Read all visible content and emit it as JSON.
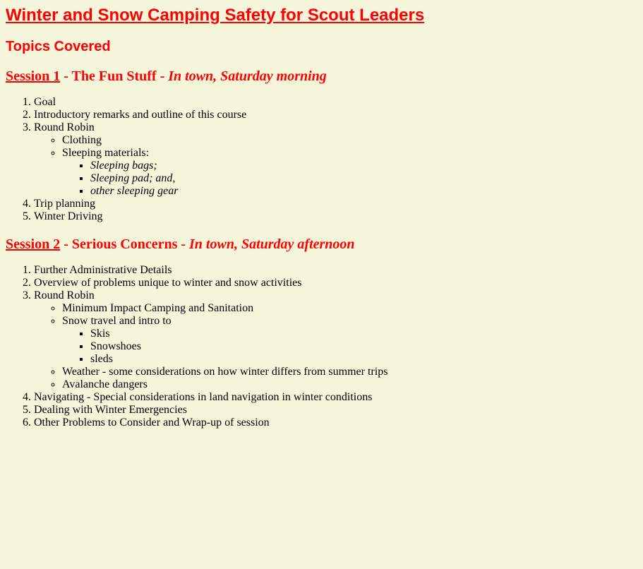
{
  "page": {
    "title": "Winter and Snow Camping Safety for Scout Leaders",
    "topics_heading": "Topics Covered"
  },
  "session1": {
    "link": "Session 1",
    "sep1": " - The Fun Stuff - ",
    "where": "In town, Saturday morning",
    "items": [
      "Goal",
      "Introductory remarks and outline of this course",
      "Round Robin",
      "Trip planning",
      "Winter Driving"
    ],
    "round_robin": [
      "Clothing",
      "Sleeping materials:"
    ],
    "sleeping": [
      "Sleeping bags;",
      "Sleeping pad; and,",
      "other sleeping gear"
    ]
  },
  "session2": {
    "link": "Session 2",
    "sep1": " - Serious Concerns - ",
    "where": "In town, Saturday afternoon",
    "items": [
      "Further Administrative Details",
      "Overview of problems unique to winter and snow activities",
      "Round Robin",
      "Navigating - Special considerations in land navigation in winter conditions",
      "Dealing with Winter Emergencies",
      "Other Problems to Consider and Wrap-up of session"
    ],
    "round_robin": [
      "Minimum Impact Camping and Sanitation",
      "Snow travel and intro to",
      "Weather - some considerations on how winter differs from summer trips",
      "Avalanche dangers"
    ],
    "snow_travel": [
      "Skis",
      "Snowshoes",
      "sleds"
    ]
  },
  "colors": {
    "background": "#f5f5dc",
    "heading": "#ff0000"
  }
}
